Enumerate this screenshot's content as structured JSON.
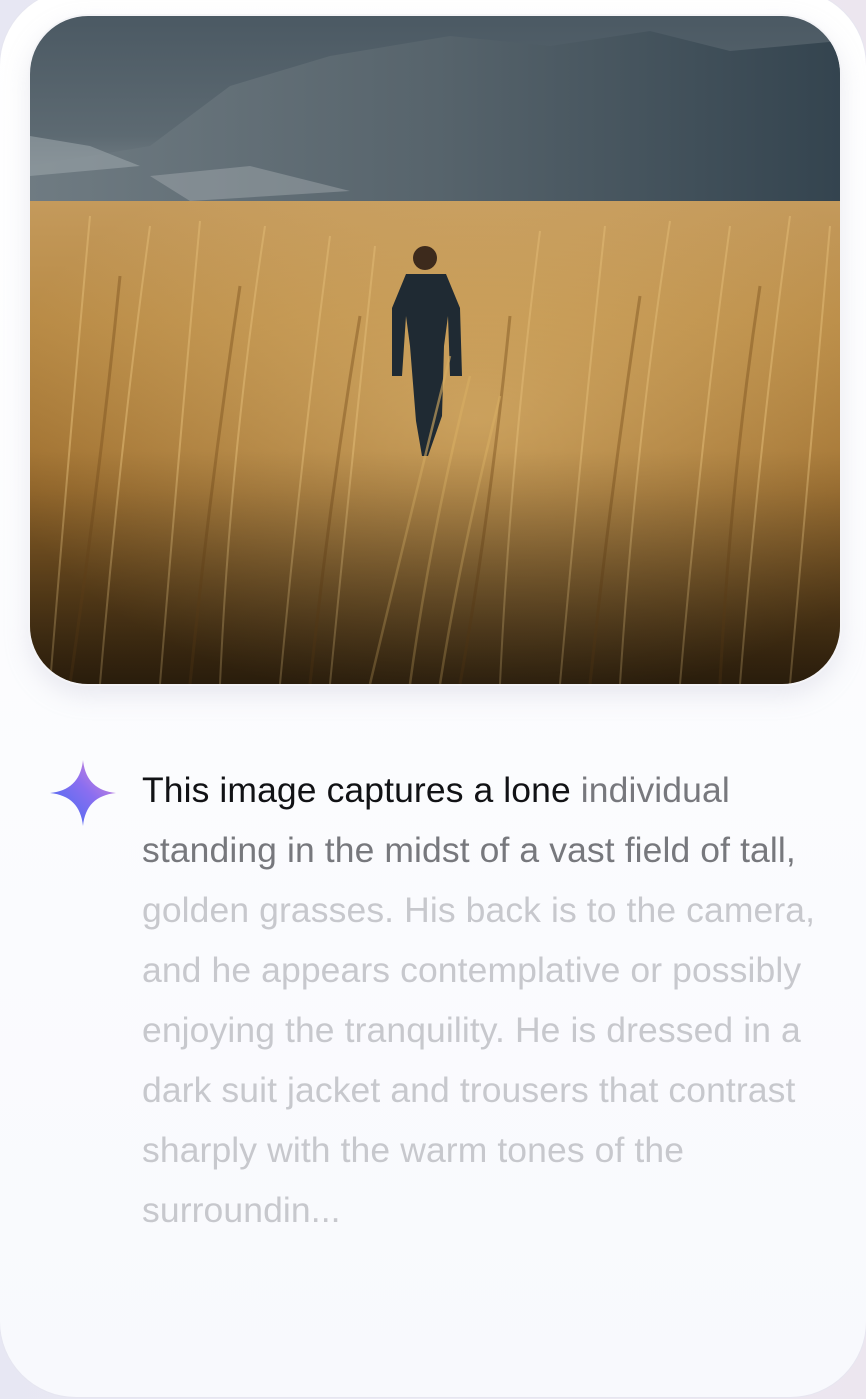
{
  "image": {
    "subject": "photo-man-in-golden-grass-field"
  },
  "ai_caption": {
    "icon": "ai-sparkle-icon",
    "text_strong": "This image captures a lone ",
    "text_medium": "individual standing in the midst of a vast field of tall, ",
    "text_faded": "golden grasses. His back is to the camera, and he appears contemplative or possibly enjoying the tranquility. He is dressed in a dark suit jacket and trousers that contrast sharply with the warm tones of the surroundin..."
  },
  "colors": {
    "text_strong": "#111215",
    "text_medium": "#77787d",
    "text_faded": "#c7c8cd",
    "sparkle_gradient": [
      "#3b6cf2",
      "#8a6ef0",
      "#e98fd0"
    ]
  }
}
